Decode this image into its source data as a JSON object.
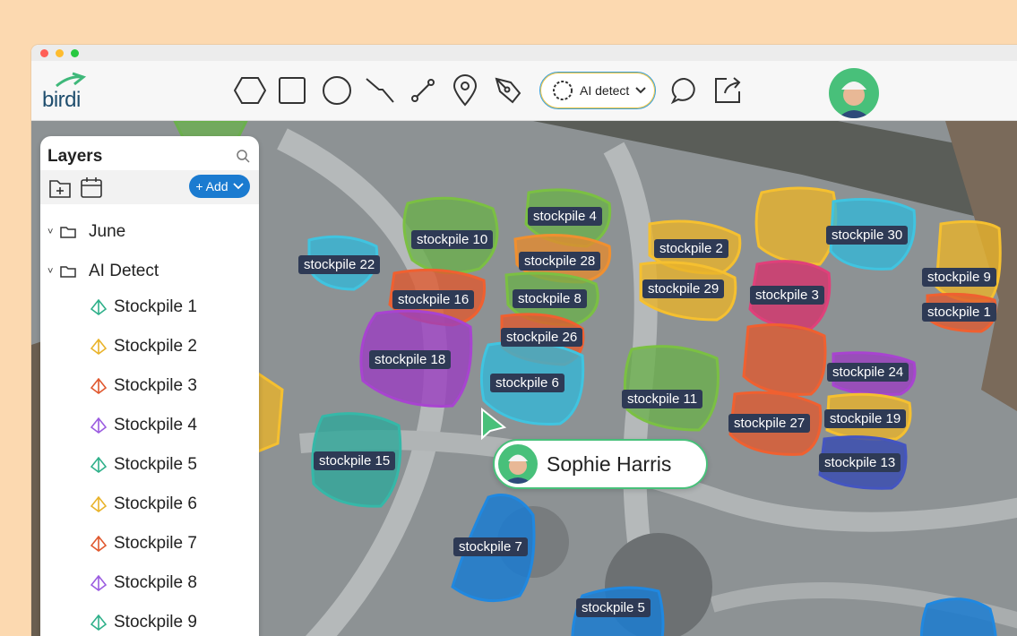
{
  "app": {
    "logo_text": "birdi"
  },
  "toolbar": {
    "tools": [
      "hexagon-tool",
      "rectangle-tool",
      "circle-tool",
      "line-tool",
      "measure-tool",
      "pin-tool",
      "pen-tool"
    ],
    "ai_detect_label": "AI detect",
    "comment_icon": "comment-icon",
    "share_icon": "share-icon"
  },
  "layers": {
    "title": "Layers",
    "add_label": "+ Add",
    "groups": [
      {
        "name": "June"
      },
      {
        "name": "AI Detect"
      }
    ],
    "items": [
      {
        "label": "Stockpile 1",
        "color": "#2fb08a"
      },
      {
        "label": "Stockpile 2",
        "color": "#e9b32a"
      },
      {
        "label": "Stockpile 3",
        "color": "#e0582e"
      },
      {
        "label": "Stockpile 4",
        "color": "#9b5ce0"
      },
      {
        "label": "Stockpile 5",
        "color": "#2fb08a"
      },
      {
        "label": "Stockpile 6",
        "color": "#e9b32a"
      },
      {
        "label": "Stockpile 7",
        "color": "#e0582e"
      },
      {
        "label": "Stockpile 8",
        "color": "#9b5ce0"
      },
      {
        "label": "Stockpile 9",
        "color": "#2fb08a"
      }
    ]
  },
  "map_labels": {
    "s1": "stockpile 1",
    "s2": "stockpile 2",
    "s3": "stockpile 3",
    "s4": "stockpile 4",
    "s5": "stockpile 5",
    "s6": "stockpile 6",
    "s7": "stockpile 7",
    "s8": "stockpile 8",
    "s9": "stockpile 9",
    "s10": "stockpile 10",
    "s11": "stockpile 11",
    "s13": "stockpile 13",
    "s15": "stockpile 15",
    "s16": "stockpile 16",
    "s18": "stockpile 18",
    "s19": "stockpile 19",
    "s22": "stockpile 22",
    "s24": "stockpile 24",
    "s26": "stockpile 26",
    "s27": "stockpile 27",
    "s28": "stockpile 28",
    "s29": "stockpile 29",
    "s30": "stockpile 30"
  },
  "collaborator": {
    "name": "Sophie Harris"
  },
  "colors": {
    "accent": "#1b7bd0",
    "collab": "#48c07a"
  }
}
